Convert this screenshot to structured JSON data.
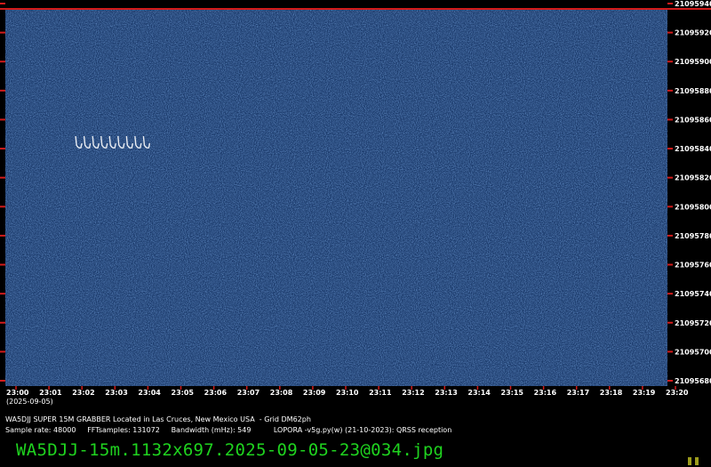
{
  "chart_data": {
    "type": "heatmap",
    "title": "",
    "y_axis": {
      "ticks": [
        "21095940",
        "21095920",
        "21095900",
        "21095880",
        "21095860",
        "21095840",
        "21095820",
        "21095800",
        "21095780",
        "21095760",
        "21095740",
        "21095720",
        "21095700",
        "21095680"
      ],
      "range": [
        21095680,
        21095940
      ],
      "units": ""
    },
    "x_axis": {
      "ticks": [
        "23:00",
        "23:01",
        "23:02",
        "23:03",
        "23:04",
        "23:05",
        "23:06",
        "23:07",
        "23:08",
        "23:09",
        "23:10",
        "23:11",
        "23:12",
        "23:13",
        "23:14",
        "23:15",
        "23:16",
        "23:17",
        "23:18",
        "23:19",
        "23:20"
      ],
      "range": [
        "23:00",
        "23:20"
      ],
      "date": "(2025-09-05)"
    },
    "signal": {
      "description": "",
      "time_start": "23:01",
      "time_end": "23:04",
      "freq_center": 21095840
    },
    "colors": {
      "background": "#1b3a6b",
      "noise_light": "#3f6fb8",
      "signal": "#ffffff",
      "axis_ticks": "#d11b1b",
      "top_line": "#d11b1b"
    }
  },
  "captions": {
    "line1": "WA5DJJ SUPER 15M GRABBER Located in Las Cruces, New Mexico USA  - Grid DM62ph",
    "line2": "Sample rate: 48000     FFTsamples: 131072     Bandwidth (mHz): 549          LOPORA -v5g.py(w) (21-10-2023): QRSS reception"
  },
  "filename": "WA5DJJ-15m.1132x697.2025-09-05-23@034.jpg"
}
